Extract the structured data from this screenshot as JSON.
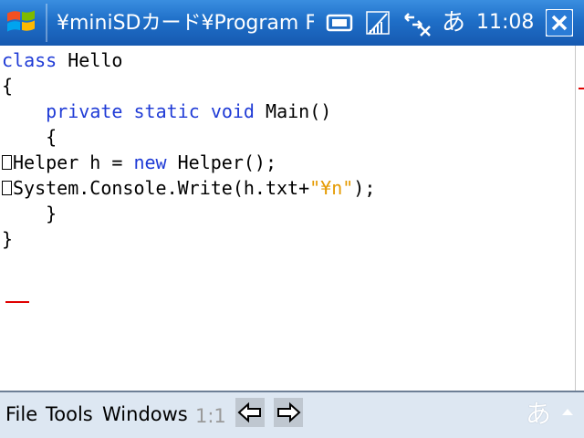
{
  "titlebar": {
    "title": "¥miniSDカード¥Program Files",
    "ime_indicator": "あ",
    "clock": "11:08",
    "icons": [
      "windows-start-icon",
      "keyboard-icon",
      "signal-off-icon",
      "connectivity-icon",
      "close-icon"
    ]
  },
  "editor": {
    "line1": {
      "kw": "class",
      "rest": " Hello"
    },
    "line2": "{",
    "line3": {
      "indent": "    ",
      "kw1": "private",
      "kw2": "static",
      "kw3": "void",
      "rest": " Main()"
    },
    "line4": "    {",
    "line5": {
      "a": "Helper h = ",
      "kw": "new",
      "b": " Helper();"
    },
    "line6": {
      "a": "System.Console.Write(h.txt+",
      "str": "\"¥n\"",
      "b": ");"
    },
    "line7": "    }",
    "line8": "}"
  },
  "menubar": {
    "file": "File",
    "tools": "Tools",
    "windows": "Windows",
    "position": "1:1",
    "ime_indicator": "あ"
  },
  "colors": {
    "keyword": "#1f3bd6",
    "string": "#e59a00",
    "titlebar": "#1f6fc8",
    "menubar": "#dde7f2"
  }
}
